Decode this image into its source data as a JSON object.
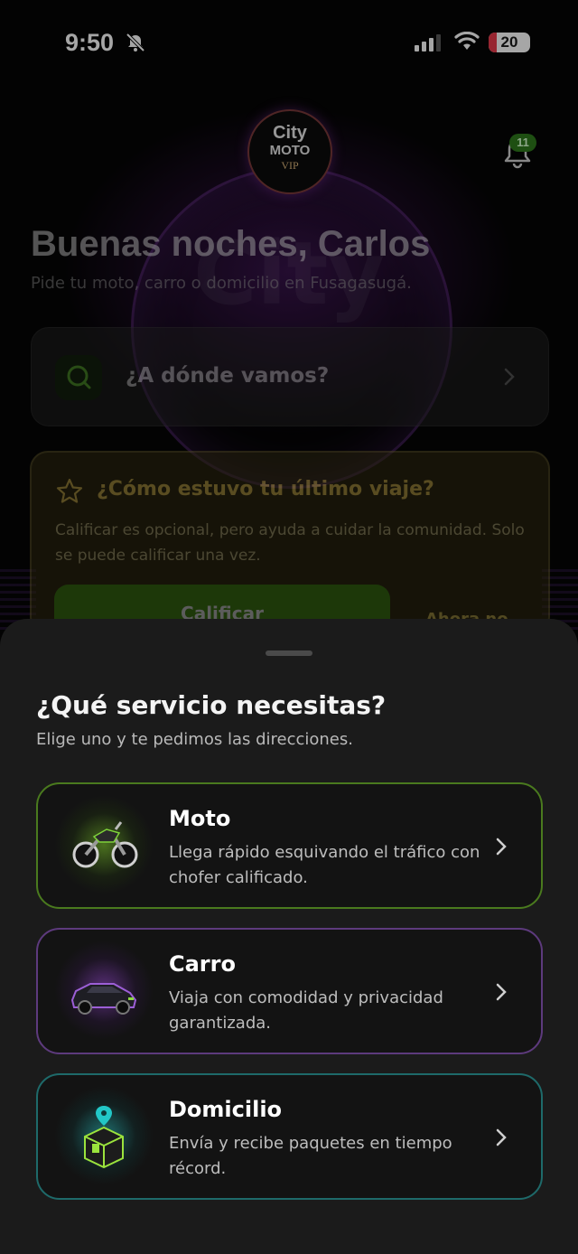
{
  "status_bar": {
    "time": "9:50",
    "battery": "20",
    "battery_level_percent": 20
  },
  "logo": {
    "line1": "City",
    "line2": "MOTO",
    "line3": "VIP"
  },
  "notifications": {
    "count": "11"
  },
  "header": {
    "greeting": "Buenas noches, Carlos",
    "subtitle": "Pide tu moto, carro o domicilio en Fusagasugá."
  },
  "search": {
    "placeholder": "¿A dónde vamos?"
  },
  "rating_card": {
    "title": "¿Cómo estuvo tu último viaje?",
    "description": "Calificar es opcional, pero ayuda a cuidar la comunidad. Solo se puede calificar una vez.",
    "rate_label": "Calificar",
    "later_label": "Ahora no"
  },
  "sheet": {
    "title": "¿Qué servicio necesitas?",
    "subtitle": "Elige uno y te pedimos las direcciones.",
    "services": [
      {
        "name": "Moto",
        "description": "Llega rápido esquivando el tráfico con chofer calificado.",
        "icon": "motorcycle-icon"
      },
      {
        "name": "Carro",
        "description": "Viaja con comodidad y privacidad garantizada.",
        "icon": "car-icon"
      },
      {
        "name": "Domicilio",
        "description": "Envía y recibe paquetes en tiempo récord.",
        "icon": "package-icon"
      }
    ]
  },
  "colors": {
    "accent_green": "#4f9a18",
    "moto_border": "#4a7a1e",
    "carro_border": "#5d3a7d",
    "domicilio_border": "#1e6a6a",
    "rating_accent": "#f5d35a"
  }
}
